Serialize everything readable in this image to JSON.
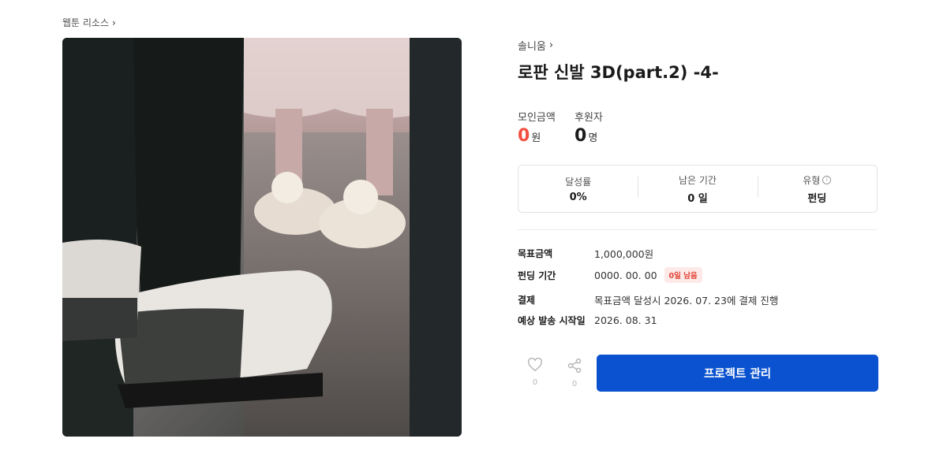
{
  "breadcrumb": {
    "label": "웹툰 리소스"
  },
  "creator": {
    "name": "솔니움"
  },
  "project": {
    "title": "로판 신발 3D(part.2) -4-"
  },
  "stats": {
    "amount": {
      "label": "모인금액",
      "value": "0",
      "unit": "원"
    },
    "supporters": {
      "label": "후원자",
      "value": "0",
      "unit": "명"
    }
  },
  "summary": {
    "rate": {
      "label": "달성률",
      "value": "0%"
    },
    "remaining": {
      "label": "남은 기간",
      "value": "0 일"
    },
    "type": {
      "label": "유형",
      "value": "펀딩",
      "info_icon": "info-icon"
    }
  },
  "details": {
    "goal": {
      "label": "목표금액",
      "value": "1,000,000원"
    },
    "period": {
      "label": "펀딩 기간",
      "value": "0000. 00. 00",
      "badge": "0일 남음"
    },
    "payment": {
      "label": "결제",
      "value": "목표금액 달성시 2026. 07. 23에 결제 진행"
    },
    "delivery": {
      "label": "예상 발송 시작일",
      "value": "2026. 08. 31"
    }
  },
  "actions": {
    "like": {
      "icon": "heart-icon",
      "count": "0"
    },
    "share": {
      "icon": "share-icon",
      "count": "0"
    },
    "manage_label": "프로젝트 관리"
  },
  "colors": {
    "accent": "#0a52cf",
    "highlight": "#f24f3f"
  }
}
